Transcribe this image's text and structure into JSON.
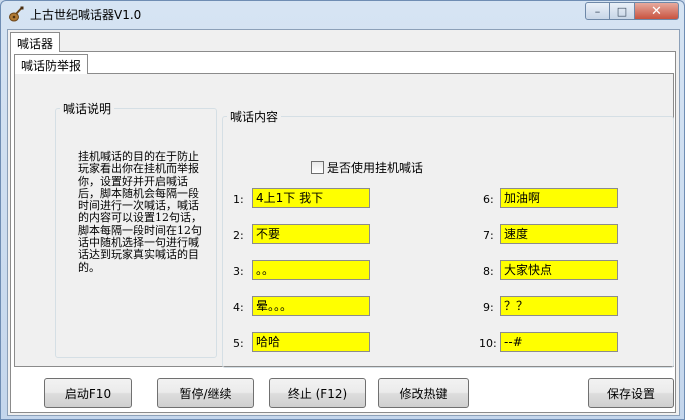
{
  "window": {
    "title": "上古世纪喊话器V1.0",
    "controls": {
      "minimize": "–",
      "maximize": "□",
      "close": "✕"
    }
  },
  "tabs": {
    "outer": "喊话器",
    "inner": "喊话防举报"
  },
  "description": {
    "group_label": "喊话说明",
    "text": "挂机喊话的目的在于防止玩家看出你在挂机而举报你，设置好并开启喊话后，脚本随机会每隔一段时间进行一次喊话，喊话的内容可以设置12句话，脚本每隔一段时间在12句话中随机选择一句进行喊话达到玩家真实喊话的目的。"
  },
  "content": {
    "group_label": "喊话内容",
    "use_checkbox_label": "是否使用挂机喊话",
    "use_checkbox_checked": false,
    "fields": [
      {
        "label": "1:",
        "value": "4上1下 我下"
      },
      {
        "label": "2:",
        "value": "不要"
      },
      {
        "label": "3:",
        "value": "。。"
      },
      {
        "label": "4:",
        "value": "晕。。。"
      },
      {
        "label": "5:",
        "value": "哈哈"
      },
      {
        "label": "6:",
        "value": "加油啊"
      },
      {
        "label": "7:",
        "value": "速度"
      },
      {
        "label": "8:",
        "value": "大家快点"
      },
      {
        "label": "9:",
        "value": "？？"
      },
      {
        "label": "10:",
        "value": "--#"
      }
    ],
    "field_color": "#ffff00"
  },
  "buttons": {
    "start": "启动F10",
    "pause": "暂停/继续",
    "stop": "终止 (F12)",
    "hotkey": "修改热键",
    "save": "保存设置"
  }
}
